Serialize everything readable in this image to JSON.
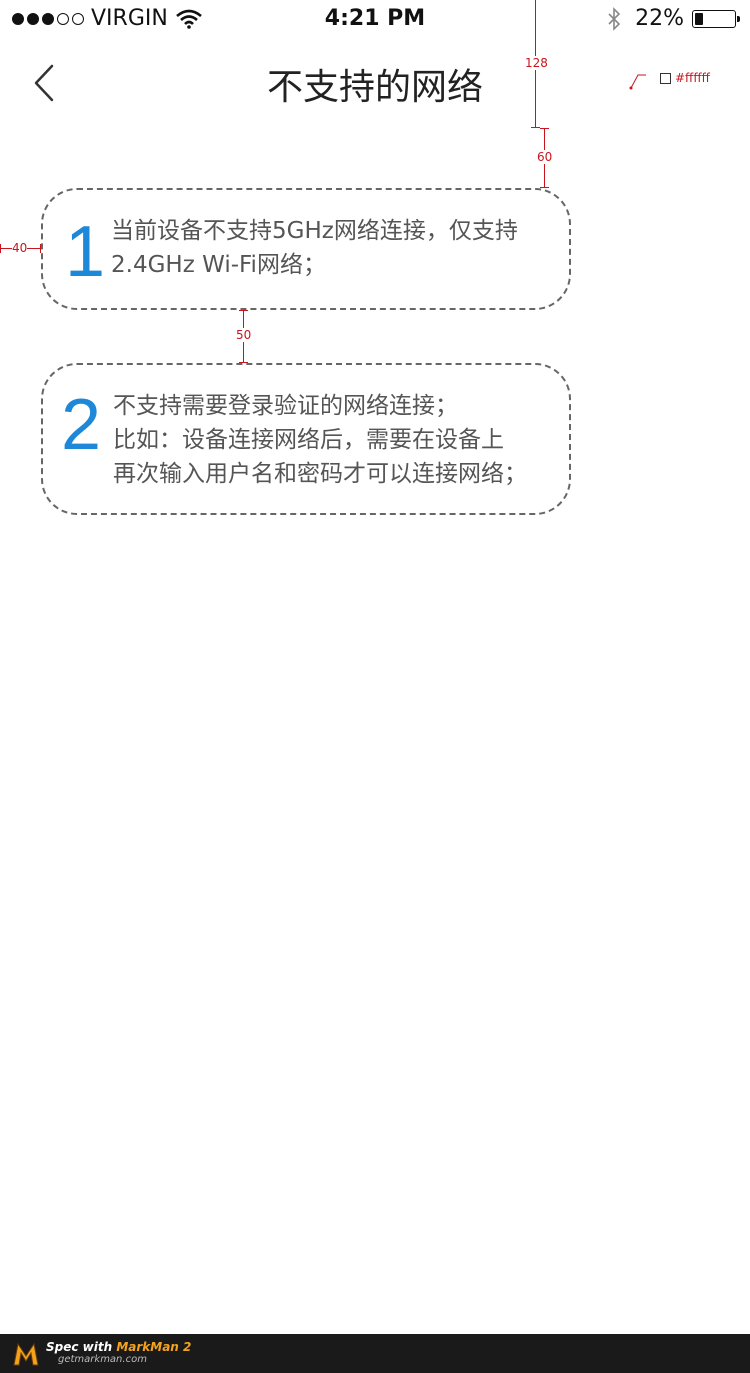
{
  "status_bar": {
    "carrier": "VIRGIN",
    "time": "4:21 PM",
    "battery_percent": "22%",
    "battery_level": 0.22,
    "signal_bars_filled": 3,
    "signal_bars_total": 5
  },
  "nav": {
    "title": "不支持的网络",
    "back_icon": "chevron-left-icon"
  },
  "cards": [
    {
      "number": "1",
      "lines": [
        "当前设备不支持5GHz网络连接，仅支持",
        "2.4GHz Wi-Fi网络；"
      ]
    },
    {
      "number": "2",
      "lines": [
        "不支持需要登录验证的网络连接；",
        "比如：设备连接网络后，需要在设备上",
        "再次输入用户名和密码才可以连接网络；"
      ]
    }
  ],
  "annotations": {
    "nav_height": "128",
    "card_top_gap": "60",
    "left_margin": "40",
    "card_gap": "50",
    "bg_color_label": "#ffffff"
  },
  "colors": {
    "accent": "#1e88d8",
    "annotation": "#c8151d",
    "dashed_border": "#666666",
    "background": "#ffffff"
  },
  "footer": {
    "spec_prefix": "Spec with ",
    "brand": "MarkMan 2",
    "url": "getmarkman.com"
  }
}
